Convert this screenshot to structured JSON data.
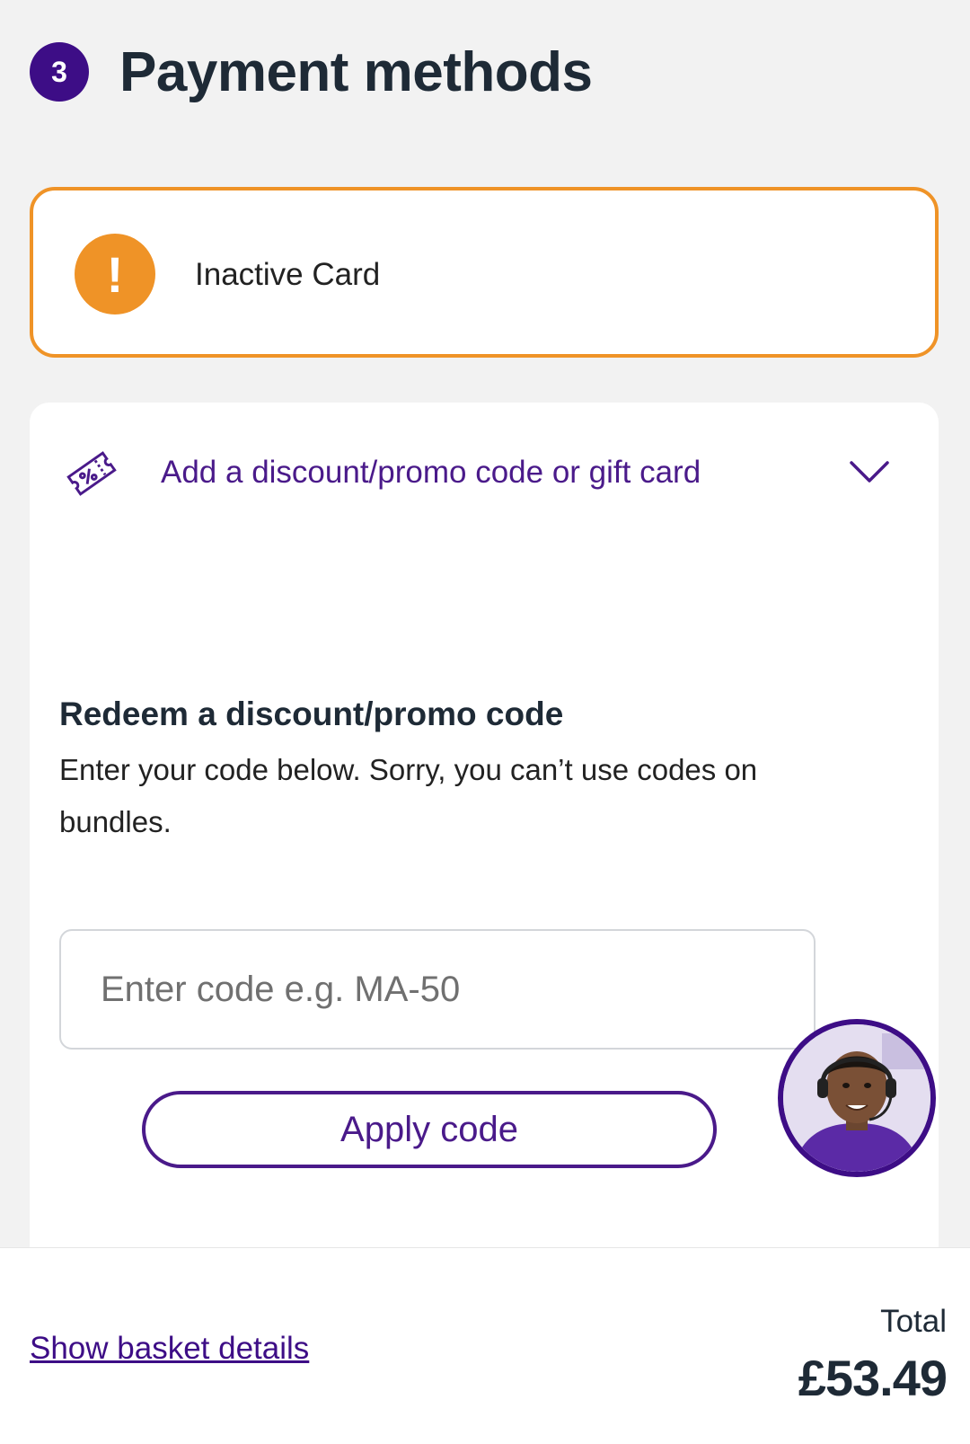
{
  "step": {
    "number": "3",
    "title": "Payment methods"
  },
  "alert": {
    "text": "Inactive Card",
    "icon": "exclamation-icon",
    "color": "#ef9327"
  },
  "promo": {
    "toggle_label": "Add a discount/promo code or gift card",
    "icon": "discount-ticket-icon",
    "chevron": "chevron-down-icon",
    "redeem_title": "Redeem a discount/promo code",
    "redeem_description": "Enter your code below. Sorry, you can’t use codes on bundles.",
    "input_placeholder": "Enter code e.g. MA-50",
    "input_value": "",
    "apply_label": "Apply code"
  },
  "support": {
    "avatar": "live-chat-agent-avatar"
  },
  "footer": {
    "basket_link": "Show basket details",
    "total_label": "Total",
    "total_value": "£53.49"
  },
  "colors": {
    "brand": "#3d0d86",
    "accent_text": "#4a1a8a",
    "warning": "#ef9327",
    "background": "#f2f2f2"
  }
}
